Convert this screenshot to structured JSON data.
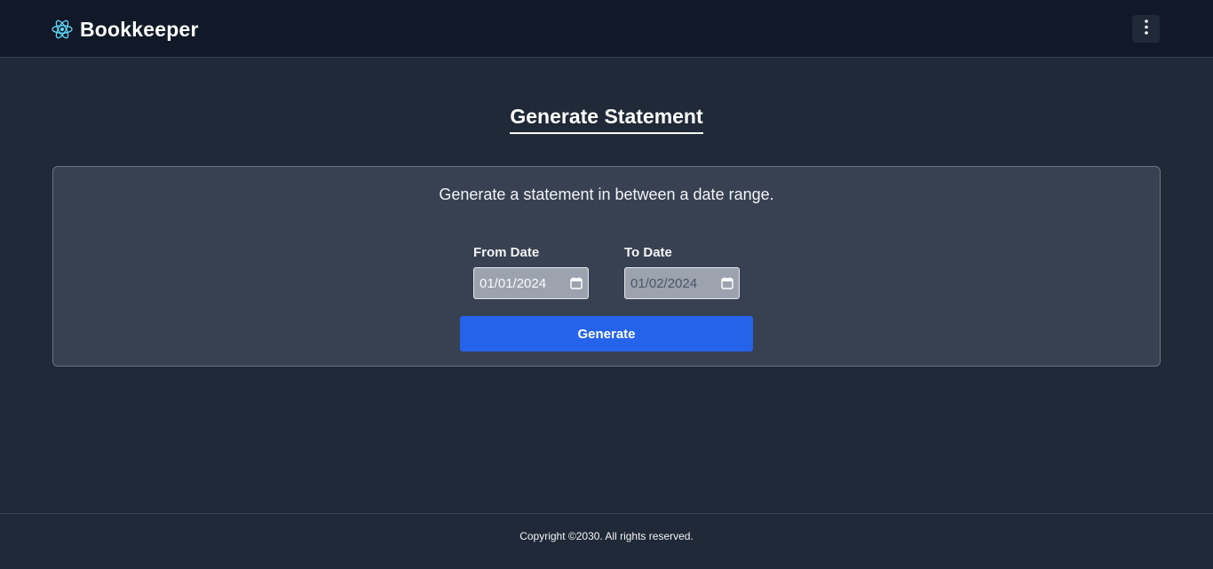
{
  "header": {
    "brand_name": "Bookkeeper",
    "logo_icon": "react-atom-icon",
    "menu_icon": "vertical-ellipsis-icon"
  },
  "main": {
    "page_title": "Generate Statement",
    "description": "Generate a statement in between a date range.",
    "from_date": {
      "label": "From Date",
      "value": "01/01/2024"
    },
    "to_date": {
      "label": "To Date",
      "value": "01/02/2024"
    },
    "generate_label": "Generate"
  },
  "footer": {
    "copyright": "Copyright ©2030. All rights reserved."
  },
  "colors": {
    "navbar_bg": "#111827",
    "page_bg": "#1f2937",
    "card_bg": "#374151",
    "primary_button": "#2563eb",
    "logo_accent": "#61dafb"
  }
}
